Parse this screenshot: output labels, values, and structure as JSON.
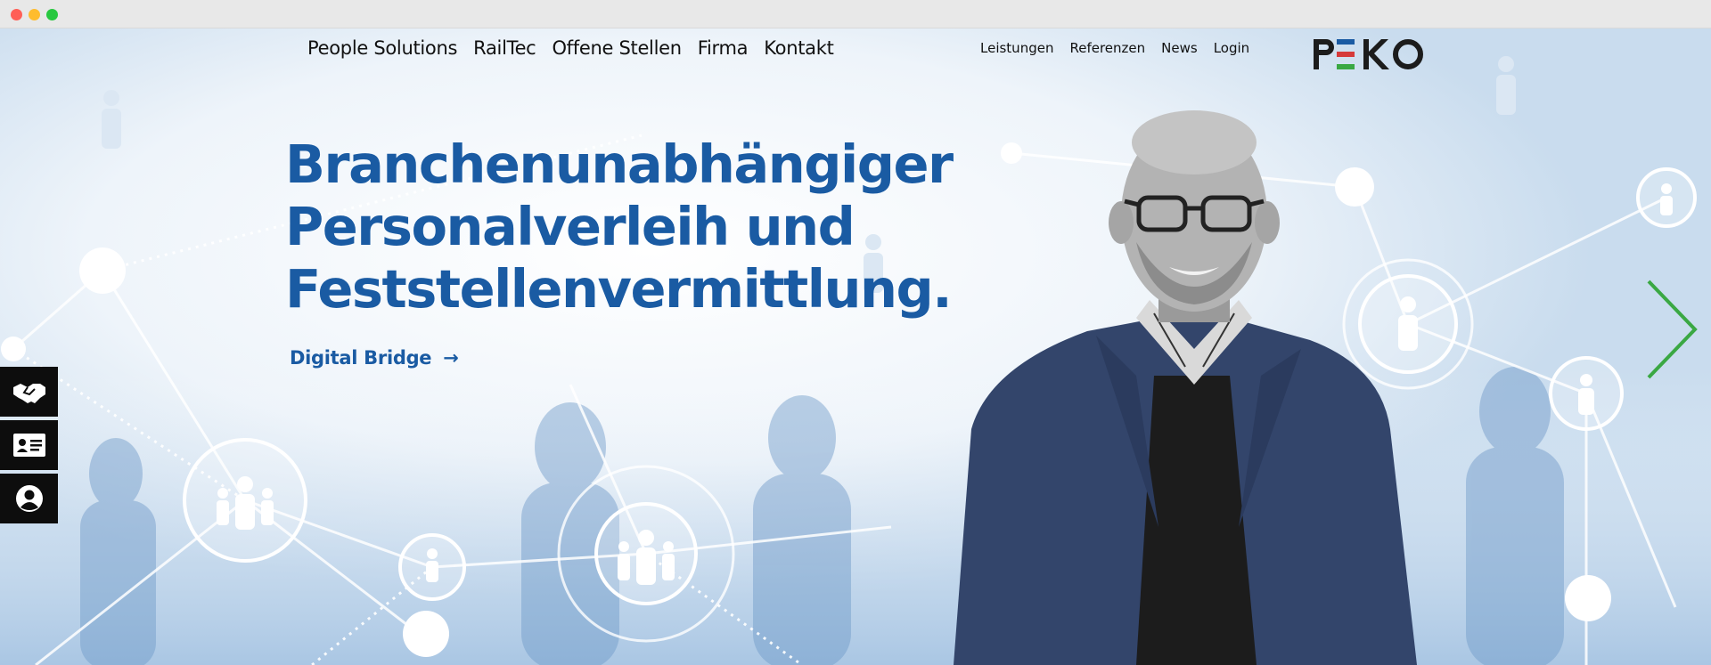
{
  "nav": {
    "main": [
      "People Solutions",
      "RailTec",
      "Offene Stellen",
      "Firma",
      "Kontakt"
    ],
    "secondary": [
      "Leistungen",
      "Referenzen",
      "News",
      "Login"
    ]
  },
  "logo": {
    "text": "PEKO",
    "stripe_colors": [
      "#1a5ba3",
      "#d63a3a",
      "#3aa843"
    ]
  },
  "hero": {
    "title_lines": [
      "Branchenunabhängiger",
      "Personalverleih und",
      "Feststellenvermittlung."
    ],
    "link_label": "Digital Bridge",
    "link_arrow": "→"
  },
  "side_buttons": [
    {
      "icon": "handshake-icon"
    },
    {
      "icon": "id-card-icon"
    },
    {
      "icon": "user-circle-icon"
    }
  ],
  "colors": {
    "brand_blue": "#1a5ba3",
    "arrow_green": "#3aa843",
    "side_bar_bg": "#0d0d0d"
  }
}
